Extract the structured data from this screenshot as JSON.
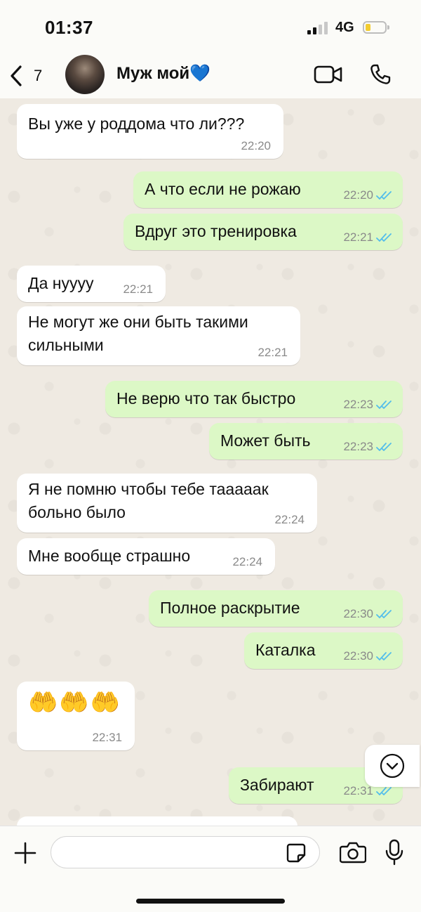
{
  "status_bar": {
    "time": "01:37",
    "network": "4G"
  },
  "header": {
    "back_count": "7",
    "contact_name": "Муж мой💙"
  },
  "messages": [
    {
      "dir": "in",
      "text": "Вы уже у роддома что ли???",
      "time": "22:20"
    },
    {
      "dir": "out",
      "text": "А что если не рожаю",
      "time": "22:20"
    },
    {
      "dir": "out",
      "text": "Вдруг это тренировка",
      "time": "22:21"
    },
    {
      "dir": "in",
      "text": "Да нуууу",
      "time": "22:21"
    },
    {
      "dir": "in",
      "text": "Не могут же они быть такими\nсильными",
      "time": "22:21"
    },
    {
      "dir": "out",
      "text": "Не верю что так быстро",
      "time": "22:23"
    },
    {
      "dir": "out",
      "text": "Может быть",
      "time": "22:23"
    },
    {
      "dir": "in",
      "text": "Я не помню чтобы тебе тааааак\nбольно было",
      "time": "22:24"
    },
    {
      "dir": "in",
      "text": "Мне вообще страшно",
      "time": "22:24"
    },
    {
      "dir": "out",
      "text": "Полное раскрытие",
      "time": "22:30"
    },
    {
      "dir": "out",
      "text": "Каталка",
      "time": "22:30"
    },
    {
      "dir": "in",
      "text": "🤲🤲🤲",
      "time": "22:31"
    },
    {
      "dir": "out",
      "text": "Забирают",
      "time": "22:31"
    }
  ],
  "composer": {
    "placeholder": ""
  },
  "colors": {
    "incoming": "#ffffff",
    "outgoing": "#dcf8c6",
    "read_ticks": "#53bdeb",
    "chat_bg": "#efeae2"
  },
  "icons": [
    "back-chevron-icon",
    "video-call-icon",
    "phone-icon",
    "scroll-down-icon",
    "plus-icon",
    "sticker-icon",
    "camera-icon",
    "mic-icon",
    "read-ticks-icon"
  ]
}
